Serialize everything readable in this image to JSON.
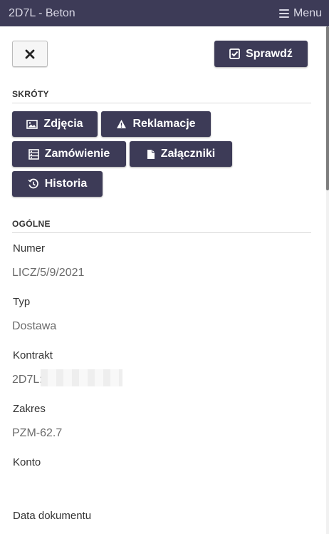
{
  "header": {
    "title": "2D7L - Beton",
    "menu_label": "Menu",
    "menu_icon": "hamburger-icon"
  },
  "toolbar": {
    "close_icon": "close-icon",
    "check_label": "Sprawdź",
    "check_icon": "checkbox-icon"
  },
  "shortcuts": {
    "title": "SKRÓTY",
    "items": [
      {
        "label": "Zdjęcia",
        "icon": "image-icon"
      },
      {
        "label": "Reklamacje",
        "icon": "warning-icon"
      },
      {
        "label": "Zamówienie",
        "icon": "order-list-icon"
      },
      {
        "label": "Załączniki",
        "icon": "file-icon"
      },
      {
        "label": "Historia",
        "icon": "history-icon"
      }
    ]
  },
  "general": {
    "title": "OGÓLNE",
    "fields": [
      {
        "label": "Numer",
        "value": "LICZ/5/9/2021"
      },
      {
        "label": "Typ",
        "value": "Dostawa"
      },
      {
        "label": "Kontrakt",
        "value": "2D7L:"
      },
      {
        "label": "Zakres",
        "value": "PZM-62.7"
      },
      {
        "label": "Konto",
        "value": ""
      },
      {
        "label": "Data dokumentu",
        "value": ""
      }
    ]
  },
  "colors": {
    "primary": "#3d3b57",
    "header_text": "#d8d7e4",
    "value_text": "#6b6b6b"
  }
}
